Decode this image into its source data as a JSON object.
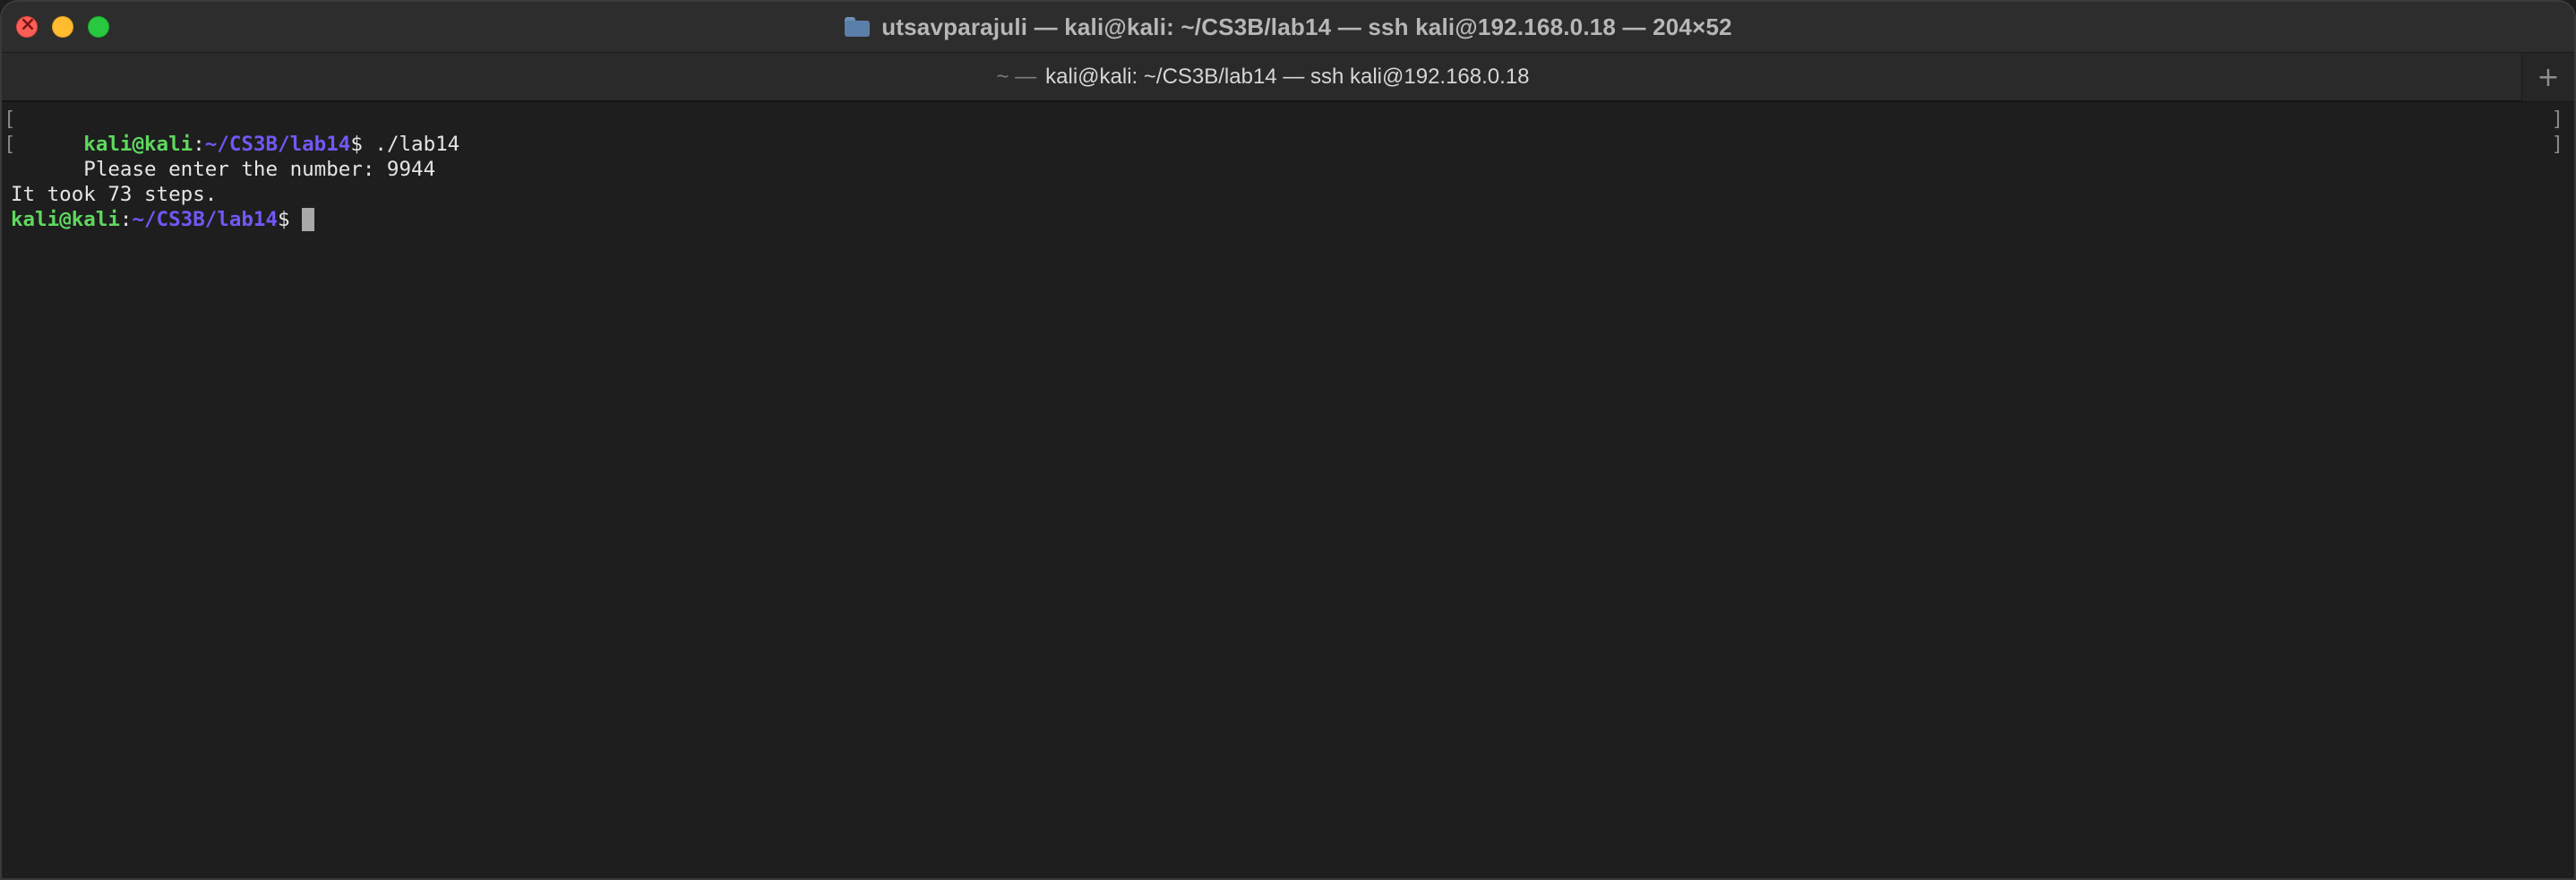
{
  "window": {
    "title": "utsavparajuli — kali@kali: ~/CS3B/lab14 — ssh kali@192.168.0.18 — 204×52"
  },
  "tab": {
    "prefix": "~ —",
    "label": "kali@kali: ~/CS3B/lab14 — ssh kali@192.168.0.18",
    "new_tab_glyph": "+"
  },
  "terminal": {
    "prompt_user": "kali@kali",
    "prompt_sep": ":",
    "prompt_path": "~/CS3B/lab14",
    "prompt_dollar": "$",
    "command": " ./lab14",
    "output_line1": "Please enter the number: 9944",
    "output_line2": "It took 73 steps.",
    "bracket_left": "[",
    "bracket_right": "]"
  },
  "colors": {
    "prompt_user": "#5fd85f",
    "prompt_path": "#7357f5",
    "background": "#1e1e1e"
  },
  "icons": {
    "title_icon": "folder-icon",
    "traffic_lights": [
      "close-icon",
      "minimize-icon",
      "zoom-icon"
    ]
  }
}
